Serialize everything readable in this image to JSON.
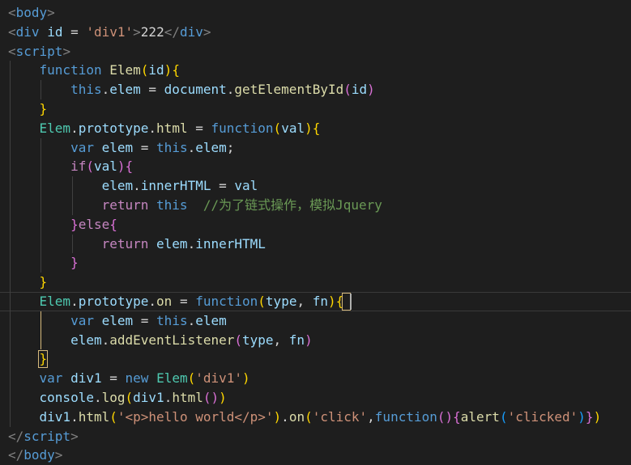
{
  "theme": {
    "background": "#1e1e1e",
    "colors": {
      "tag": "#569cd6",
      "punct": "#808080",
      "attr": "#9cdcfe",
      "string": "#ce9178",
      "keyword": "#569cd6",
      "control": "#c586c0",
      "func": "#dcdcaa",
      "type": "#4ec9b0",
      "variable": "#9cdcfe",
      "text": "#d4d4d4",
      "comment": "#6a9955",
      "bracket1": "#ffd700",
      "bracket2": "#da70d6",
      "bracket3": "#179fff"
    }
  },
  "lines": [
    [
      [
        "punct",
        "<"
      ],
      [
        "tag",
        "body"
      ],
      [
        "punct",
        ">"
      ]
    ],
    [
      [
        "punct",
        "<"
      ],
      [
        "tag",
        "div"
      ],
      [
        "text",
        " "
      ],
      [
        "attr",
        "id"
      ],
      [
        "text",
        " = "
      ],
      [
        "string",
        "'div1'"
      ],
      [
        "punct",
        ">"
      ],
      [
        "text",
        "222"
      ],
      [
        "punct",
        "</"
      ],
      [
        "tag",
        "div"
      ],
      [
        "punct",
        ">"
      ]
    ],
    [
      [
        "punct",
        "<"
      ],
      [
        "tag",
        "script"
      ],
      [
        "punct",
        ">"
      ]
    ],
    [
      [
        "text",
        "    "
      ],
      [
        "keyword",
        "function"
      ],
      [
        "text",
        " "
      ],
      [
        "func",
        "Elem"
      ],
      [
        "bracket1",
        "("
      ],
      [
        "variable",
        "id"
      ],
      [
        "bracket1",
        ")"
      ],
      [
        "bracket1",
        "{"
      ]
    ],
    [
      [
        "text",
        "        "
      ],
      [
        "keyword",
        "this"
      ],
      [
        "text",
        "."
      ],
      [
        "variable",
        "elem"
      ],
      [
        "text",
        " = "
      ],
      [
        "variable",
        "document"
      ],
      [
        "text",
        "."
      ],
      [
        "func",
        "getElementById"
      ],
      [
        "bracket2",
        "("
      ],
      [
        "variable",
        "id"
      ],
      [
        "bracket2",
        ")"
      ]
    ],
    [
      [
        "text",
        "    "
      ],
      [
        "bracket1",
        "}"
      ]
    ],
    [
      [
        "text",
        "    "
      ],
      [
        "type",
        "Elem"
      ],
      [
        "text",
        "."
      ],
      [
        "variable",
        "prototype"
      ],
      [
        "text",
        "."
      ],
      [
        "func",
        "html"
      ],
      [
        "text",
        " = "
      ],
      [
        "keyword",
        "function"
      ],
      [
        "bracket1",
        "("
      ],
      [
        "variable",
        "val"
      ],
      [
        "bracket1",
        ")"
      ],
      [
        "bracket1",
        "{"
      ]
    ],
    [
      [
        "text",
        "        "
      ],
      [
        "keyword",
        "var"
      ],
      [
        "text",
        " "
      ],
      [
        "variable",
        "elem"
      ],
      [
        "text",
        " = "
      ],
      [
        "keyword",
        "this"
      ],
      [
        "text",
        "."
      ],
      [
        "variable",
        "elem"
      ],
      [
        "text",
        ";"
      ]
    ],
    [
      [
        "text",
        "        "
      ],
      [
        "control",
        "if"
      ],
      [
        "bracket2",
        "("
      ],
      [
        "variable",
        "val"
      ],
      [
        "bracket2",
        ")"
      ],
      [
        "bracket2",
        "{"
      ]
    ],
    [
      [
        "text",
        "            "
      ],
      [
        "variable",
        "elem"
      ],
      [
        "text",
        "."
      ],
      [
        "variable",
        "innerHTML"
      ],
      [
        "text",
        " = "
      ],
      [
        "variable",
        "val"
      ]
    ],
    [
      [
        "text",
        "            "
      ],
      [
        "control",
        "return"
      ],
      [
        "text",
        " "
      ],
      [
        "keyword",
        "this"
      ],
      [
        "text",
        "  "
      ],
      [
        "comment",
        "//为了链式操作，模拟Jquery"
      ]
    ],
    [
      [
        "text",
        "        "
      ],
      [
        "bracket2",
        "}"
      ],
      [
        "control",
        "else"
      ],
      [
        "bracket2",
        "{"
      ]
    ],
    [
      [
        "text",
        "            "
      ],
      [
        "control",
        "return"
      ],
      [
        "text",
        " "
      ],
      [
        "variable",
        "elem"
      ],
      [
        "text",
        "."
      ],
      [
        "variable",
        "innerHTML"
      ]
    ],
    [
      [
        "text",
        "        "
      ],
      [
        "bracket2",
        "}"
      ]
    ],
    [
      [
        "text",
        "    "
      ],
      [
        "bracket1",
        "}"
      ]
    ],
    [
      [
        "text",
        "    "
      ],
      [
        "type",
        "Elem"
      ],
      [
        "text",
        "."
      ],
      [
        "variable",
        "prototype"
      ],
      [
        "text",
        "."
      ],
      [
        "func",
        "on"
      ],
      [
        "text",
        " = "
      ],
      [
        "keyword",
        "function"
      ],
      [
        "bracket1",
        "("
      ],
      [
        "variable",
        "type"
      ],
      [
        "text",
        ", "
      ],
      [
        "variable",
        "fn"
      ],
      [
        "bracket1",
        ")"
      ],
      [
        "bracket1",
        "{"
      ]
    ],
    [
      [
        "text",
        "        "
      ],
      [
        "keyword",
        "var"
      ],
      [
        "text",
        " "
      ],
      [
        "variable",
        "elem"
      ],
      [
        "text",
        " = "
      ],
      [
        "keyword",
        "this"
      ],
      [
        "text",
        "."
      ],
      [
        "variable",
        "elem"
      ]
    ],
    [
      [
        "text",
        "        "
      ],
      [
        "variable",
        "elem"
      ],
      [
        "text",
        "."
      ],
      [
        "func",
        "addEventListener"
      ],
      [
        "bracket2",
        "("
      ],
      [
        "variable",
        "type"
      ],
      [
        "text",
        ", "
      ],
      [
        "variable",
        "fn"
      ],
      [
        "bracket2",
        ")"
      ]
    ],
    [
      [
        "text",
        "    "
      ],
      [
        "bracket1",
        "}"
      ]
    ],
    [
      [
        "text",
        "    "
      ],
      [
        "keyword",
        "var"
      ],
      [
        "text",
        " "
      ],
      [
        "variable",
        "div1"
      ],
      [
        "text",
        " = "
      ],
      [
        "keyword",
        "new"
      ],
      [
        "text",
        " "
      ],
      [
        "type",
        "Elem"
      ],
      [
        "bracket1",
        "("
      ],
      [
        "string",
        "'div1'"
      ],
      [
        "bracket1",
        ")"
      ]
    ],
    [
      [
        "text",
        "    "
      ],
      [
        "variable",
        "console"
      ],
      [
        "text",
        "."
      ],
      [
        "func",
        "log"
      ],
      [
        "bracket1",
        "("
      ],
      [
        "variable",
        "div1"
      ],
      [
        "text",
        "."
      ],
      [
        "func",
        "html"
      ],
      [
        "bracket2",
        "()"
      ],
      [
        "bracket1",
        ")"
      ]
    ],
    [
      [
        "text",
        "    "
      ],
      [
        "variable",
        "div1"
      ],
      [
        "text",
        "."
      ],
      [
        "func",
        "html"
      ],
      [
        "bracket1",
        "("
      ],
      [
        "string",
        "'<p>hello world</p>'"
      ],
      [
        "bracket1",
        ")"
      ],
      [
        "text",
        "."
      ],
      [
        "func",
        "on"
      ],
      [
        "bracket1",
        "("
      ],
      [
        "string",
        "'click'"
      ],
      [
        "text",
        ","
      ],
      [
        "keyword",
        "function"
      ],
      [
        "bracket2",
        "()"
      ],
      [
        "bracket2",
        "{"
      ],
      [
        "func",
        "alert"
      ],
      [
        "bracket3",
        "("
      ],
      [
        "string",
        "'clicked'"
      ],
      [
        "bracket3",
        ")"
      ],
      [
        "bracket2",
        "}"
      ],
      [
        "bracket1",
        ")"
      ]
    ],
    [
      [
        "punct",
        "</"
      ],
      [
        "tag",
        "script"
      ],
      [
        "punct",
        ">"
      ]
    ],
    [
      [
        "punct",
        "</"
      ],
      [
        "tag",
        "body"
      ],
      [
        "punct",
        ">"
      ]
    ]
  ]
}
